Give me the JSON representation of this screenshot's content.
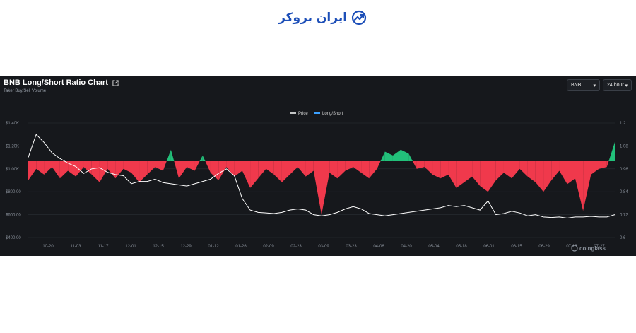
{
  "header": {
    "brand_name": "ایران بروکر"
  },
  "chart_header": {
    "title": "BNB Long/Short Ratio Chart",
    "subtitle": "Taker Buy/Sell Volume",
    "symbol_select": "BNB",
    "interval_select": "24 hour"
  },
  "watermark": "coinglass",
  "colors": {
    "background": "#16181c",
    "long": "#22c07a",
    "short": "#f0394c",
    "price": "#ffffff",
    "legend_ratio": "#3ba0ff",
    "brand": "#1d4fb8"
  },
  "icons": {
    "external_link": "external-link-icon",
    "dropdown": "caret-down-icon",
    "logo": "trend-arrow-icon"
  },
  "chart_data": {
    "type": "area",
    "title": "BNB Long/Short Ratio Chart",
    "legend": [
      "Price",
      "Long/Short"
    ],
    "legend_position": "top-center",
    "x_labels": [
      "10-20",
      "11-03",
      "11-17",
      "12-01",
      "12-15",
      "12-29",
      "01-12",
      "01-26",
      "02-09",
      "02-23",
      "03-09",
      "03-23",
      "04-06",
      "04-20",
      "05-04",
      "05-18",
      "06-01",
      "06-15",
      "06-29",
      "07-13",
      "07-27"
    ],
    "y_left": {
      "ticks": [
        "$400.00",
        "$600.00",
        "$800.00",
        "$1.00K",
        "$1.20K",
        "$1.40K"
      ],
      "range": [
        400,
        1400
      ]
    },
    "y_right": {
      "ticks": [
        "0.6",
        "0.72",
        "0.84",
        "0.96",
        "1.08",
        "1.2"
      ],
      "range": [
        0.6,
        1.2
      ]
    },
    "baseline_ratio": 1.0,
    "grid": true,
    "series": [
      {
        "name": "Price",
        "axis": "left",
        "values": [
          1100,
          1300,
          1230,
          1140,
          1090,
          1050,
          1020,
          960,
          1000,
          1010,
          970,
          950,
          940,
          870,
          890,
          890,
          910,
          880,
          870,
          860,
          850,
          870,
          890,
          910,
          960,
          1000,
          940,
          740,
          640,
          620,
          615,
          610,
          620,
          640,
          650,
          640,
          600,
          590,
          600,
          620,
          650,
          670,
          650,
          610,
          600,
          590,
          600,
          610,
          620,
          630,
          640,
          650,
          660,
          680,
          670,
          680,
          660,
          640,
          720,
          600,
          610,
          630,
          615,
          590,
          600,
          580,
          575,
          580,
          570,
          580,
          580,
          585,
          580,
          580,
          600
        ]
      },
      {
        "name": "Long/Short",
        "axis": "right",
        "values": [
          0.9,
          0.96,
          0.93,
          0.97,
          0.91,
          0.95,
          0.92,
          0.97,
          0.93,
          0.89,
          0.96,
          0.91,
          0.96,
          0.94,
          0.89,
          0.93,
          0.97,
          0.95,
          1.06,
          0.91,
          0.97,
          0.95,
          1.03,
          0.94,
          0.9,
          0.97,
          0.92,
          0.95,
          0.86,
          0.91,
          0.96,
          0.93,
          0.89,
          0.93,
          0.97,
          0.92,
          0.95,
          0.72,
          0.94,
          0.91,
          0.95,
          0.97,
          0.94,
          0.91,
          0.96,
          1.05,
          1.03,
          1.06,
          1.04,
          0.96,
          0.97,
          0.93,
          0.91,
          0.93,
          0.86,
          0.89,
          0.92,
          0.87,
          0.84,
          0.9,
          0.94,
          0.91,
          0.96,
          0.92,
          0.89,
          0.84,
          0.9,
          0.95,
          0.88,
          0.91,
          0.74,
          0.93,
          0.96,
          0.97,
          1.1
        ]
      }
    ]
  }
}
